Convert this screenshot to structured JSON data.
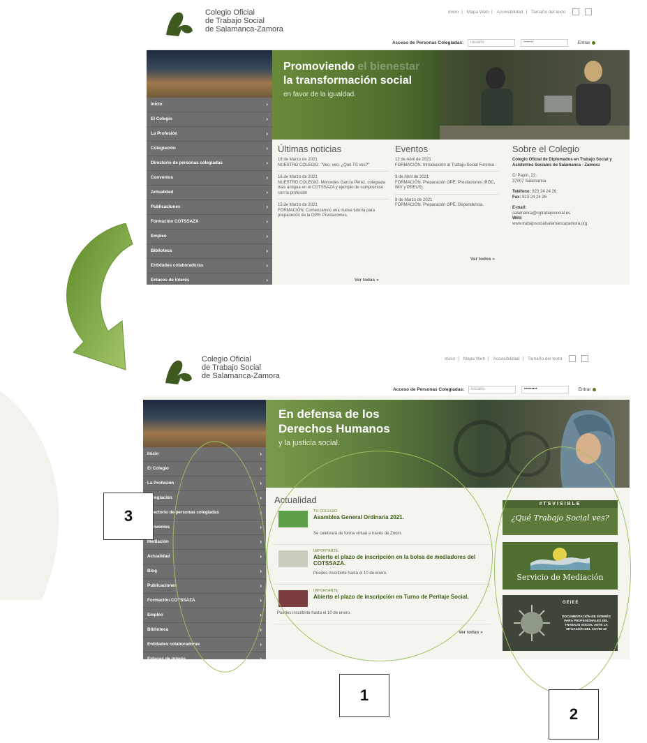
{
  "site": {
    "logo_lines": [
      "Colegio Oficial",
      "de Trabajo Social",
      "de Salamanca-Zamora"
    ],
    "top_links": [
      "Inicio",
      "Mapa Web",
      "Accesibilidad",
      "Tamaño del texto"
    ],
    "login_label": "Acceso de Personas Colegiadas:",
    "user_placeholder": "usuario",
    "password_mask_old": "•••••••",
    "password_mask_new": "•••••••••",
    "enter_label": "Entrar"
  },
  "old_site": {
    "hero_title_1": "Promoviendo",
    "hero_title_faded": "el bienestar",
    "hero_title_2": "la transformación social",
    "hero_sub": "en favor de la igualdad.",
    "menu": [
      "Inicio",
      "El Colegio",
      "La Profesión",
      "Colegiación",
      "Directorio de personas colegiadas",
      "Convenios",
      "Actualidad",
      "Publicaciones",
      "Formación COTSSAZA",
      "Empleo",
      "Biblioteca",
      "Entidades colaboradoras",
      "Enlaces de interés"
    ],
    "news": {
      "title": "Últimas noticias",
      "items": [
        {
          "date": "18 de Marzo de 2021",
          "text": "NUESTRO COLEGIO. \"Veo, veo, ¿Qué TS ves?\""
        },
        {
          "date": "16 de Marzo de 2021",
          "text": "NUESTRO COLEGIO. Mercedes García Pérez, colegiada más antigua en el COTSSAZA y ejemplo de compromiso con la profesión"
        },
        {
          "date": "15 de Marzo de 2021",
          "text": "FORMACIÓN. Comenzamos una nueva tutoría para preparación de la OPE: Prestaciones."
        }
      ],
      "more": "Ver todas »"
    },
    "events": {
      "title": "Eventos",
      "items": [
        {
          "date": "12 de Abril de 2021",
          "text": "FORMACIÓN. Introducción al Trabajo Social Forense."
        },
        {
          "date": "9 de Abril de 2021",
          "text": "FORMACIÓN. Preparación OPE: Prestaciones (ROC, IMV y PREUS)."
        },
        {
          "date": "8 de Marzo de 2021",
          "text": "FORMACIÓN. Preparación OPE: Dependencia."
        }
      ],
      "more": "Ver todos »"
    },
    "about": {
      "title": "Sobre el Colegio",
      "name": "Colegio Oficial de Diplomados en Trabajo Social y Asistentes Sociales de Salamanca - Zamora",
      "address_1": "C/ Papín, 22.",
      "address_2": "37007 Salamanca",
      "phone_label": "Teléfono:",
      "phone": "923 24 24 26",
      "fax_label": "Fax:",
      "fax": "923 24 24 26",
      "email_label": "E-mail:",
      "email": "salamanca@cgtrabajosocial.es",
      "web_label": "Web:",
      "web": "www.trabajosocialsalamancazamora.org"
    }
  },
  "new_site": {
    "hero_title_1": "En defensa de los",
    "hero_title_2": "Derechos Humanos",
    "hero_sub": "y la justicia social.",
    "menu": [
      "Inicio",
      "El Colegio",
      "La Profesión",
      "Colegiación",
      "Directorio de personas colegiadas",
      "Convenios",
      "Mediación",
      "Actualidad",
      "Blog",
      "Publicaciones",
      "Formación COTSSAZA",
      "Empleo",
      "Biblioteca",
      "Entidades colaboradoras",
      "Enlaces de interés"
    ],
    "actualidad": {
      "title": "Actualidad",
      "items": [
        {
          "tag": "TU COLEGIO",
          "title": "Asamblea General Ordinaria 2021.",
          "desc": "Se celebrará de forma virtual a través de Zoom."
        },
        {
          "tag": "IMPORTANTE",
          "title": "Abierto el plazo de inscripción en la bolsa de mediadores del COTSSAZA.",
          "desc": "Puedes inscribirte hasta el 10 de enero."
        },
        {
          "tag": "IMPORTANTE",
          "title": "Abierto el plazo de inscripción en Turno de Peritaje Social.",
          "desc": "Puedes inscribirte hasta el 10 de enero."
        }
      ],
      "more": "Ver todas »"
    },
    "ads": {
      "tsvisible_tag": "#TSVISIBLE",
      "tsvisible_text": "¿Qué Trabajo Social ves?",
      "mediacion": "Servicio de Mediación",
      "covid_tag": "GEIEE",
      "covid_text": "DOCUMENTACIÓN DE INTERÉS PARA PROFESIONALES DEL TRABAJO SOCIAL ANTE LA SITUACIÓN DEL COVID-19"
    }
  },
  "labels": {
    "one": "1",
    "two": "2",
    "three": "3"
  },
  "colors": {
    "accent": "#5a7a1f",
    "menu": "#6f6f6f",
    "arrow": "#8ab04a",
    "ring": "#9cc25e"
  }
}
